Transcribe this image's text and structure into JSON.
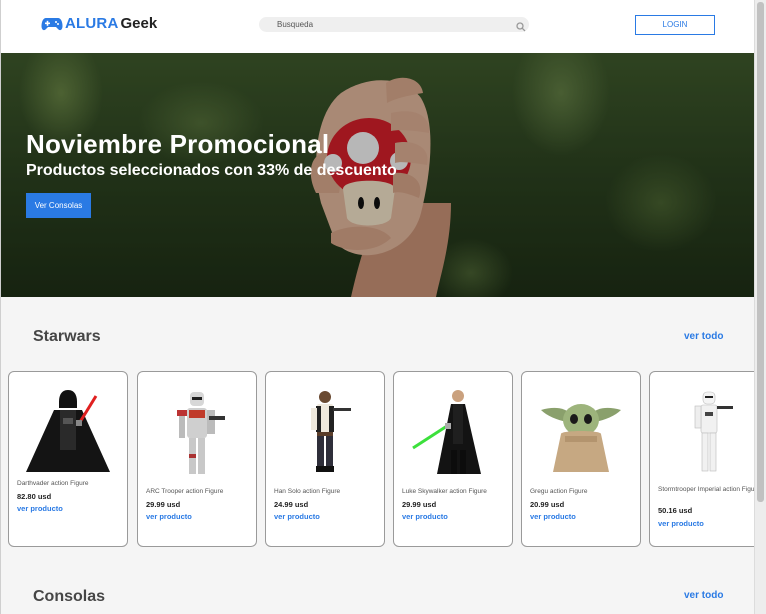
{
  "header": {
    "logo_part1": "ALURA",
    "logo_part2": "Geek",
    "search_placeholder": "Busqueda",
    "login_label": "LOGIN"
  },
  "hero": {
    "title": "Noviembre Promocional",
    "subtitle": "Productos seleccionados con 33% de descuento",
    "button_label": "Ver Consolas"
  },
  "sections": [
    {
      "title": "Starwars",
      "see_all": "ver todo",
      "products": [
        {
          "name": "Darthvader action Figure",
          "price": "82.80 usd",
          "link": "ver producto",
          "icon": "darth-vader-figure-icon"
        },
        {
          "name": "ARC Trooper action Figure",
          "price": "29.99 usd",
          "link": "ver producto",
          "icon": "arc-trooper-figure-icon"
        },
        {
          "name": "Han Solo action Figure",
          "price": "24.99 usd",
          "link": "ver producto",
          "icon": "han-solo-figure-icon"
        },
        {
          "name": "Luke Skywalker action Figure",
          "price": "29.99 usd",
          "link": "ver producto",
          "icon": "luke-skywalker-figure-icon"
        },
        {
          "name": "Gregu action Figure",
          "price": "20.99 usd",
          "link": "ver producto",
          "icon": "grogu-figure-icon"
        },
        {
          "name": "Stormtrooper Imperial action Figure",
          "price": "50.16 usd",
          "link": "ver producto",
          "icon": "stormtrooper-figure-icon"
        }
      ]
    },
    {
      "title": "Consolas",
      "see_all": "ver todo"
    }
  ],
  "colors": {
    "accent": "#2a7ae4",
    "background": "#f5f5f5"
  }
}
